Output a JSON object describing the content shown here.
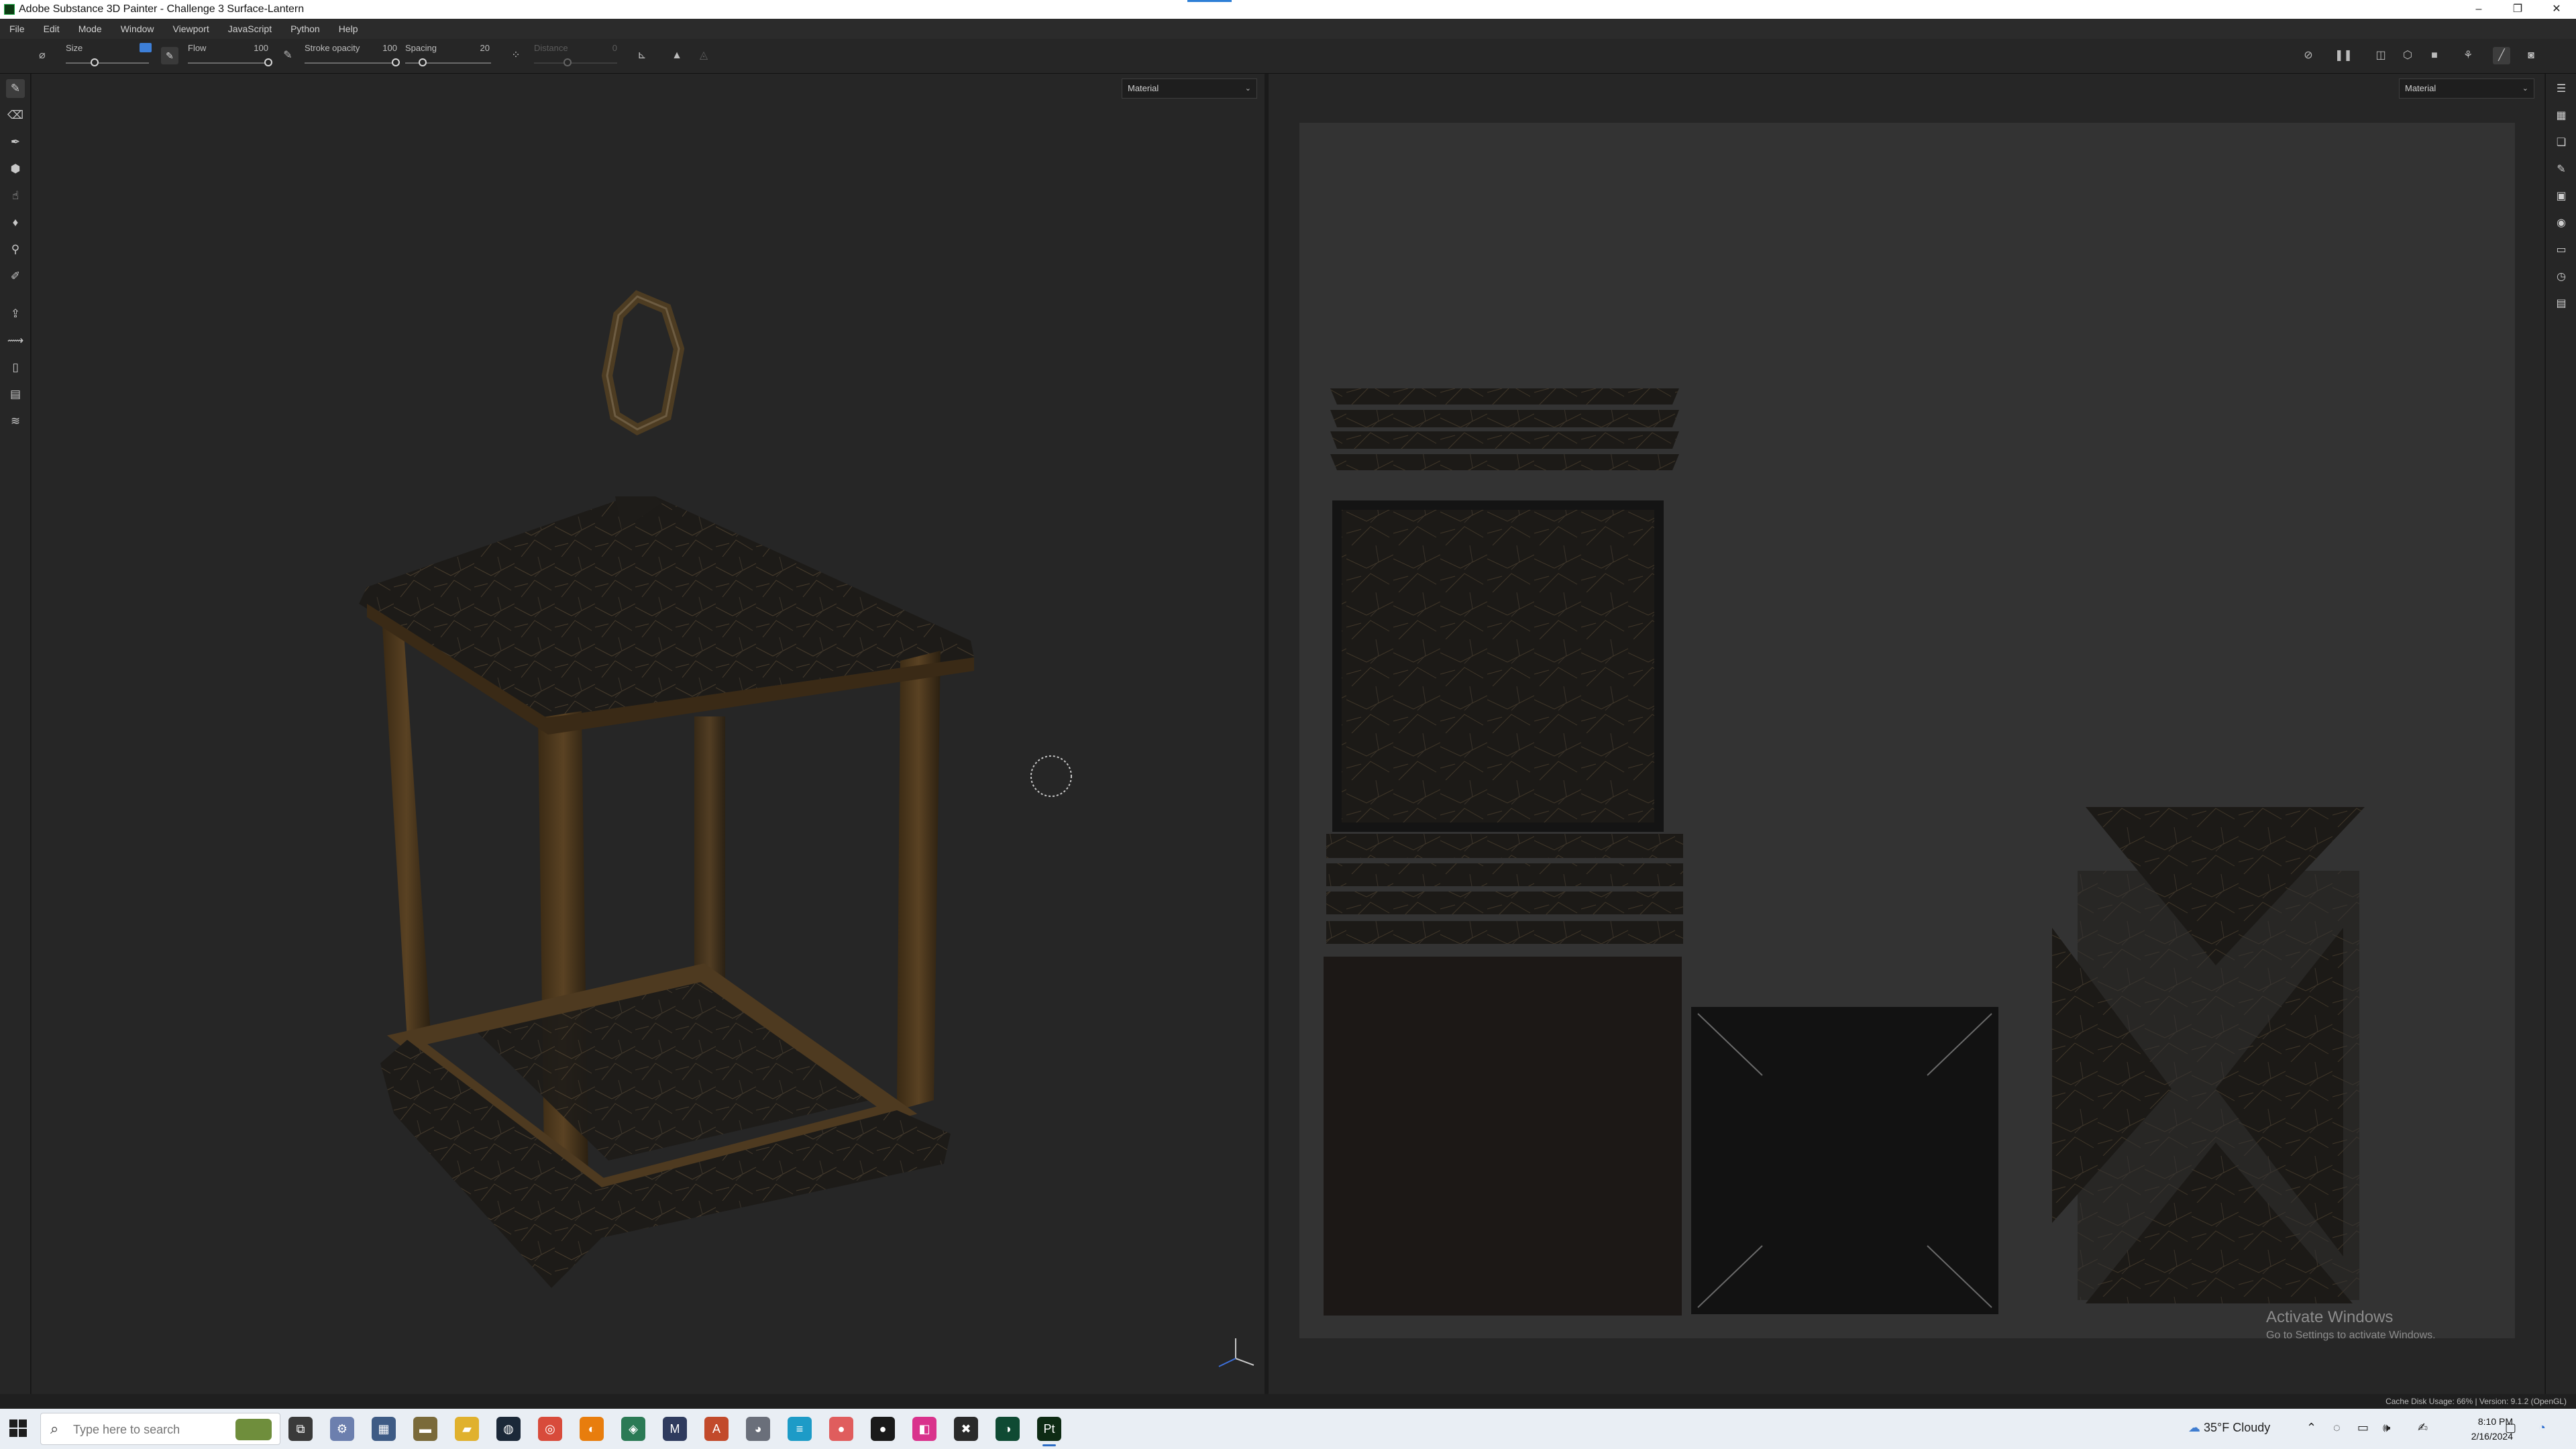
{
  "window": {
    "title": "Adobe Substance 3D Painter - Challenge 3 Surface-Lantern",
    "controls": [
      "–",
      "❐",
      "✕"
    ]
  },
  "menu": [
    "File",
    "Edit",
    "Mode",
    "Window",
    "Viewport",
    "JavaScript",
    "Python",
    "Help"
  ],
  "toolbar": {
    "size_label": "Size",
    "size_value": "",
    "flow_label": "Flow",
    "flow_value": "100",
    "stroke_opacity_label": "Stroke opacity",
    "stroke_opacity_value": "100",
    "spacing_label": "Spacing",
    "spacing_value": "20",
    "distance_label": "Distance",
    "distance_value": "0",
    "size_level": 0.35,
    "flow_level": 1.0,
    "stroke_opacity_level": 1.0,
    "spacing_level": 0.2
  },
  "viewport3d": {
    "mode_select": "Material"
  },
  "viewport2d": {
    "mode_select": "Material"
  },
  "left_tools": [
    {
      "name": "paint-tool-icon",
      "glyph": "✎"
    },
    {
      "name": "eraser-tool-icon",
      "glyph": "⌫"
    },
    {
      "name": "projection-tool-icon",
      "glyph": "✒"
    },
    {
      "name": "polygon-fill-tool-icon",
      "glyph": "⬢"
    },
    {
      "name": "smudge-tool-icon",
      "glyph": "☝"
    },
    {
      "name": "clone-tool-icon",
      "glyph": "♦"
    },
    {
      "name": "stamp-tool-icon",
      "glyph": "⚲"
    },
    {
      "name": "color-picker-tool-icon",
      "glyph": "✐"
    },
    {
      "name": "bake-tool-icon",
      "glyph": "⇪"
    },
    {
      "name": "measure-tool-icon",
      "glyph": "⟿"
    },
    {
      "name": "trash-tool-icon",
      "glyph": "▯"
    },
    {
      "name": "annotation-tool-icon",
      "glyph": "▤"
    },
    {
      "name": "layers-tool-icon",
      "glyph": "≋"
    }
  ],
  "right_tools": [
    {
      "name": "texture-set-list-icon",
      "glyph": "☰"
    },
    {
      "name": "texture-set-settings-icon",
      "glyph": "▦"
    },
    {
      "name": "layers-panel-icon",
      "glyph": "❏"
    },
    {
      "name": "properties-panel-icon",
      "glyph": "✎"
    },
    {
      "name": "display-settings-icon",
      "glyph": "▣"
    },
    {
      "name": "shader-settings-icon",
      "glyph": "◉"
    },
    {
      "name": "assets-panel-icon",
      "glyph": "▭"
    },
    {
      "name": "history-panel-icon",
      "glyph": "◷"
    },
    {
      "name": "log-panel-icon",
      "glyph": "▤"
    }
  ],
  "top_right_tools": [
    {
      "name": "hide-icon",
      "glyph": "⊘"
    },
    {
      "name": "pause-icon",
      "glyph": "❚❚"
    },
    {
      "name": "split-view-icon",
      "glyph": "◫"
    },
    {
      "name": "cube-view-icon",
      "glyph": "⬡"
    },
    {
      "name": "camera-icon",
      "glyph": "■"
    },
    {
      "name": "render-icon",
      "glyph": "⚘"
    },
    {
      "name": "brush-mode-icon",
      "glyph": "╱"
    },
    {
      "name": "screenshot-icon",
      "glyph": "◙"
    }
  ],
  "status": {
    "cache": "Cache Disk Usage: 66% | Version: 9.1.2 (OpenGL)"
  },
  "watermark": {
    "title": "Activate Windows",
    "subtitle": "Go to Settings to activate Windows."
  },
  "taskbar": {
    "search_placeholder": "Type here to search",
    "apps": [
      {
        "name": "task-view-icon",
        "glyph": "⧉",
        "color": "#3a3a3a"
      },
      {
        "name": "app-explorer-ring-icon",
        "glyph": "⚙",
        "color": "#6c7fae"
      },
      {
        "name": "calculator-icon",
        "glyph": "▦",
        "color": "#3e5b85"
      },
      {
        "name": "sticky-notes-icon",
        "glyph": "▬",
        "color": "#7a6a3a"
      },
      {
        "name": "file-explorer-icon",
        "glyph": "▰",
        "color": "#e0b12e"
      },
      {
        "name": "steam-icon",
        "glyph": "◍",
        "color": "#1b2838"
      },
      {
        "name": "chrome-icon",
        "glyph": "◎",
        "color": "#d84b3b"
      },
      {
        "name": "blender-icon",
        "glyph": "◐",
        "color": "#e87d0d"
      },
      {
        "name": "stream-deck-icon",
        "glyph": "◈",
        "color": "#2b7a55"
      },
      {
        "name": "maya-icon",
        "glyph": "M",
        "color": "#2f3b5e"
      },
      {
        "name": "autodesk-icon",
        "glyph": "A",
        "color": "#c24a2b"
      },
      {
        "name": "discord-icon",
        "glyph": "◕",
        "color": "#6a6f7a"
      },
      {
        "name": "notepad-icon",
        "glyph": "≡",
        "color": "#1d9bc7"
      },
      {
        "name": "snagit-icon",
        "glyph": "●",
        "color": "#e05d5d"
      },
      {
        "name": "obs-icon",
        "glyph": "●",
        "color": "#1a1a1a"
      },
      {
        "name": "photoshop-icon",
        "glyph": "◧",
        "color": "#d9328c"
      },
      {
        "name": "xbox-icon",
        "glyph": "✖",
        "color": "#2a2a2a"
      },
      {
        "name": "substance-designer-icon",
        "glyph": "◑",
        "color": "#0f4a33"
      },
      {
        "name": "substance-painter-icon",
        "glyph": "Pt",
        "color": "#0e2b14"
      }
    ],
    "weather": "35°F  Cloudy",
    "time": "8:10 PM",
    "date": "2/16/2024"
  }
}
